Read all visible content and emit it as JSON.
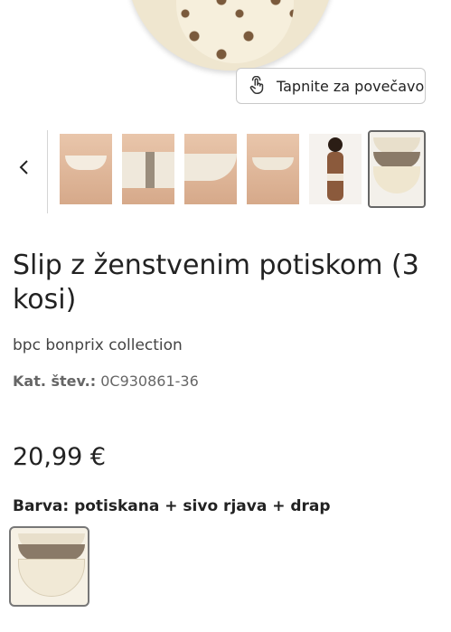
{
  "gallery": {
    "zoom_label": "Tapnite za povečavo",
    "zoom_icon": "tap-hand-icon",
    "prev_icon": "chevron-left-icon"
  },
  "product": {
    "title": "Slip z ženstvenim potiskom (3 kosi)",
    "brand": "bpc bonprix collection",
    "sku_label": "Kat. štev.:",
    "sku_value": "0C930861-36",
    "price": "20,99 €",
    "color_label": "Barva: potiskana + sivo rjava + drap"
  },
  "colors": {
    "beige": "#efe6cf",
    "taupe": "#8a7a68",
    "print_brown": "#7a5a3c"
  }
}
